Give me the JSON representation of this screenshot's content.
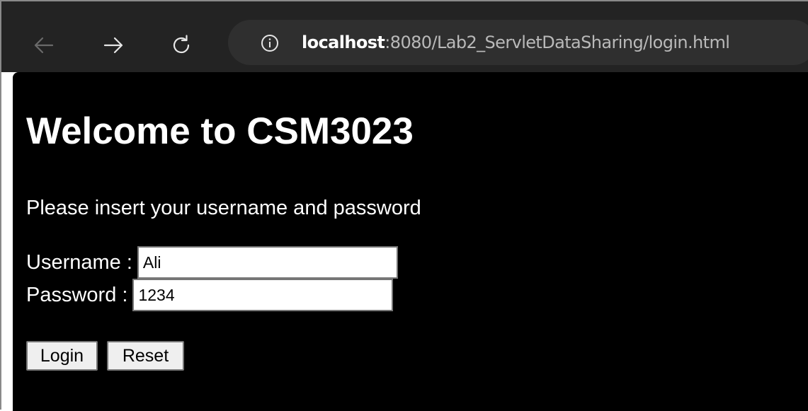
{
  "browser": {
    "url_host": "localhost",
    "url_rest": ":8080/Lab2_ServletDataSharing/login.html",
    "icons": {
      "back": "back-arrow-icon",
      "forward": "forward-arrow-icon",
      "reload": "reload-icon",
      "info": "info-icon"
    }
  },
  "page": {
    "heading": "Welcome to CSM3023",
    "instruction": "Please insert your username and password",
    "form": {
      "username_label": "Username :",
      "username_value": "Ali",
      "password_label": "Password :",
      "password_value": "1234",
      "login_label": "Login",
      "reset_label": "Reset"
    }
  },
  "colors": {
    "toolbar": "#232323",
    "address_bar": "#2f2f2f",
    "page_background": "#000000",
    "page_text": "#ffffff",
    "button_face": "#efefef"
  }
}
